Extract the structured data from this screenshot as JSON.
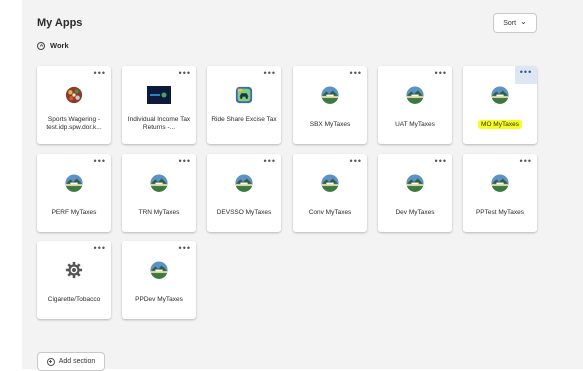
{
  "page": {
    "title": "My Apps",
    "sort_label": "Sort"
  },
  "section": {
    "title": "Work"
  },
  "apps": [
    {
      "label": "Sports Wagering - test.idp.spw.dor.k...",
      "icon": "sports-wagering-icon"
    },
    {
      "label": "Individual Income Tax Returns -...",
      "icon": "income-tax-icon"
    },
    {
      "label": "Ride Share Excise Tax",
      "icon": "ride-share-icon"
    },
    {
      "label": "SBX MyTaxes",
      "icon": "mytaxes-icon"
    },
    {
      "label": "UAT MyTaxes",
      "icon": "mytaxes-icon"
    },
    {
      "label": "MO MyTaxes",
      "icon": "mytaxes-icon",
      "highlighted": true
    },
    {
      "label": "PERF MyTaxes",
      "icon": "mytaxes-icon"
    },
    {
      "label": "TRN MyTaxes",
      "icon": "mytaxes-icon"
    },
    {
      "label": "DEVSSO MyTaxes",
      "icon": "mytaxes-icon"
    },
    {
      "label": "Conv MyTaxes",
      "icon": "mytaxes-icon"
    },
    {
      "label": "Dev MyTaxes",
      "icon": "mytaxes-icon"
    },
    {
      "label": "PPTest MyTaxes",
      "icon": "mytaxes-icon"
    },
    {
      "label": "Cigarette/Tobacco",
      "icon": "gear-icon"
    },
    {
      "label": "PPDev MyTaxes",
      "icon": "mytaxes-icon"
    }
  ],
  "footer": {
    "add_section_label": "Add section"
  },
  "colors": {
    "highlight": "#f6ff1a",
    "panel_bg": "#f3f3f3"
  }
}
